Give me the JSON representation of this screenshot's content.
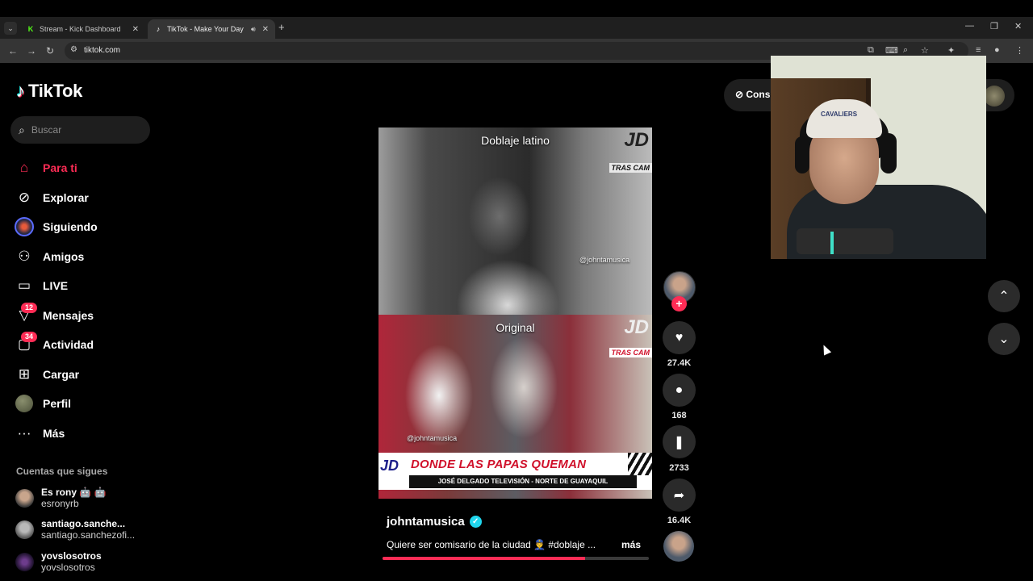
{
  "browser": {
    "tabs": [
      {
        "title": "Stream - Kick Dashboard",
        "favicon": "kick-icon"
      },
      {
        "title": "TikTok - Make Your Day",
        "favicon": "tiktok-icon",
        "active": true,
        "playing_audio": true
      }
    ],
    "url": "tiktok.com"
  },
  "tiktok": {
    "logo_text": "TikTok",
    "search_placeholder": "Buscar",
    "nav": [
      {
        "label": "Para ti",
        "icon": "home-icon",
        "active": true
      },
      {
        "label": "Explorar",
        "icon": "compass-icon"
      },
      {
        "label": "Siguiendo",
        "icon": "following-avatar-icon"
      },
      {
        "label": "Amigos",
        "icon": "friends-icon"
      },
      {
        "label": "LIVE",
        "icon": "live-tv-icon"
      },
      {
        "label": "Mensajes",
        "icon": "messages-icon",
        "badge": "12"
      },
      {
        "label": "Actividad",
        "icon": "activity-icon",
        "badge": "34"
      },
      {
        "label": "Cargar",
        "icon": "upload-icon"
      },
      {
        "label": "Perfil",
        "icon": "profile-avatar-icon"
      },
      {
        "label": "Más",
        "icon": "more-icon"
      }
    ],
    "following_title": "Cuentas que sigues",
    "following": [
      {
        "name": "Es rony 🤖 🤖",
        "handle": "esronyrb"
      },
      {
        "name": "santiago.sanche...",
        "handle": "santiago.sanchezofi..."
      },
      {
        "name": "yovslosotros",
        "handle": "yovslosotros"
      }
    ],
    "video": {
      "label_top": "Doblaje latino",
      "label_bottom": "Original",
      "watermark": "@johntamusica",
      "brand": "JD",
      "tag": "TRAS CAM",
      "banner_title": "DONDE LAS PAPAS QUEMAN",
      "banner_sub": "JOSÉ DELGADO TELEVISIÓN - NORTE  DE GUAYAQUIL",
      "progress": 0.76
    },
    "creator": "johntamusica",
    "caption": "Quiere ser comisario de la ciudad 👮‍♂️ #doblaje ...",
    "more_label": "más",
    "actions": {
      "likes": "27.4K",
      "comments": "168",
      "saves": "2733",
      "shares": "16.4K"
    },
    "top_button_text": "Cons",
    "accent_color": "#fe2c55"
  },
  "webcam": {
    "cap_text": "CAVALIERS"
  }
}
